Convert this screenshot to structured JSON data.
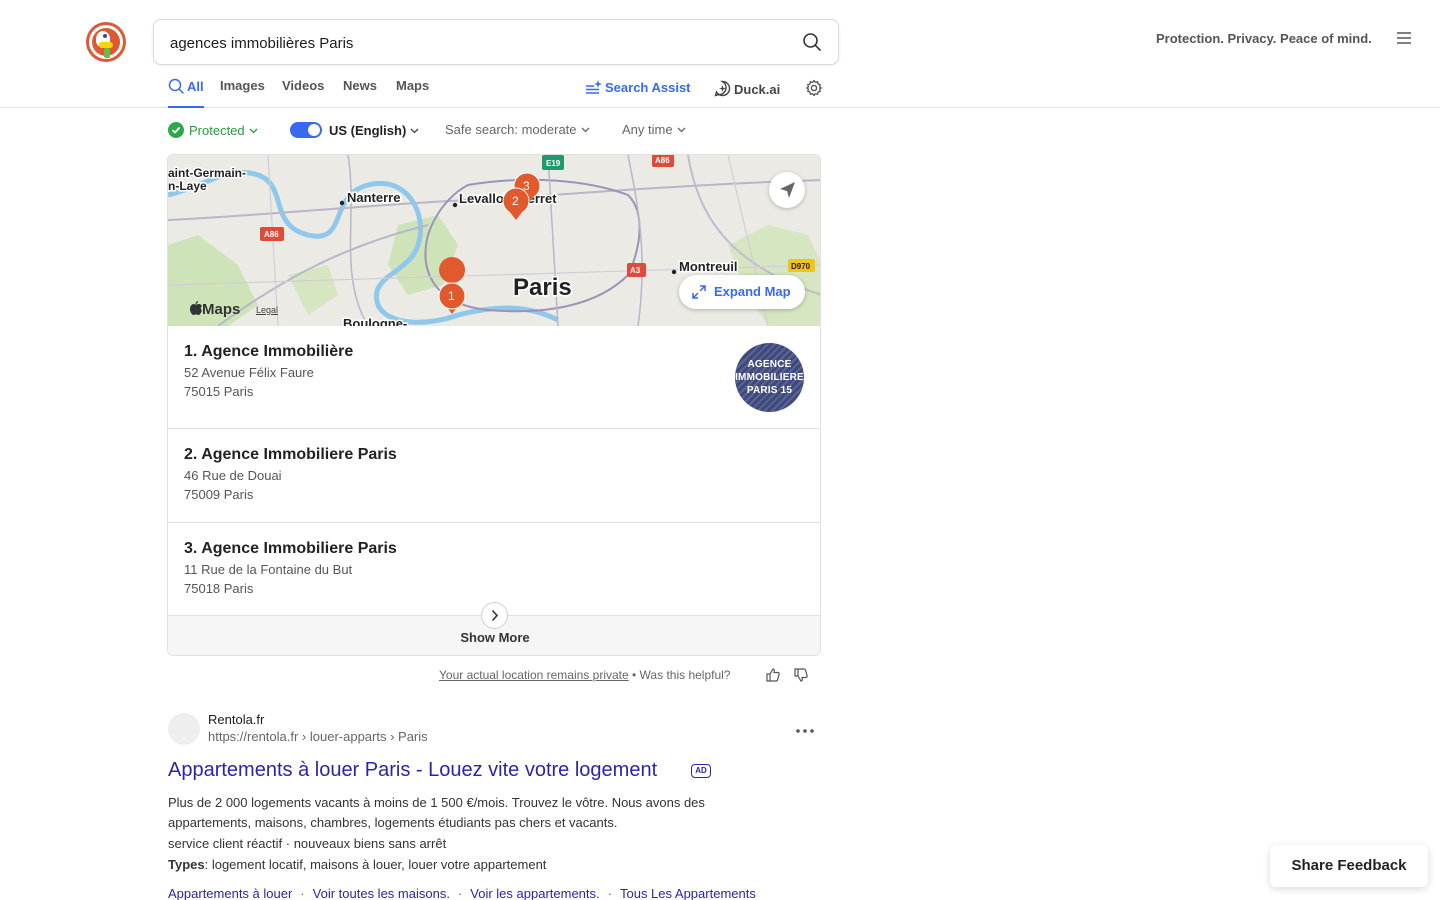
{
  "search": {
    "query": "agences immobilières Paris",
    "button_icon": "magnifier-icon"
  },
  "header": {
    "tagline": "Protection. Privacy. Peace of mind.",
    "menu_icon": "hamburger-icon"
  },
  "tabs": [
    {
      "label": "All",
      "active": true
    },
    {
      "label": "Images"
    },
    {
      "label": "Videos"
    },
    {
      "label": "News"
    },
    {
      "label": "Maps"
    }
  ],
  "assist": {
    "search_assist": "Search Assist",
    "duck_ai": "Duck.ai"
  },
  "filters": {
    "protected": "Protected",
    "region": "US (English)",
    "safe_search": "Safe search: moderate",
    "time": "Any time"
  },
  "map": {
    "labels": {
      "saint_germain_1": "aint-Germain-",
      "saint_germain_2": "n-Laye",
      "nanterre": "Nanterre",
      "levallois": "Levallois-Perret",
      "paris": "Paris",
      "montreuil": "Montreuil",
      "boulogne": "Boulogne-"
    },
    "road_badges": {
      "e19": "E19",
      "a86_top": "A86",
      "a86_left": "A86",
      "a3": "A3",
      "d970": "D970"
    },
    "markers": [
      "1",
      "2",
      "3"
    ],
    "expand_label": "Expand Map",
    "maps_brand": "Maps",
    "legal": "Legal",
    "accent": "#3969ef",
    "marker_color": "#e05a2e"
  },
  "places": [
    {
      "title": "1. Agence Immobilière",
      "line1": "52 Avenue Félix Faure",
      "line2": "75015 Paris",
      "logo_text": [
        "AGENCE",
        "IMMOBILIERE",
        "PARIS 15"
      ]
    },
    {
      "title": "2. Agence Immobiliere Paris",
      "line1": "46 Rue de Douai",
      "line2": "75009 Paris"
    },
    {
      "title": "3. Agence Immobiliere Paris",
      "line1": "11 Rue de la Fontaine du But",
      "line2": "75018 Paris"
    }
  ],
  "show_more": "Show More",
  "privacy": {
    "link": "Your actual location remains private",
    "question": "• Was this helpful?"
  },
  "result": {
    "site_name": "Rentola.fr",
    "url": "https://rentola.fr › louer-apparts › Paris",
    "title": "Appartements à louer Paris - Louez vite votre logement",
    "ad": "AD",
    "snippet1": "Plus de 2 000 logements vacants à moins de 1 500 €/mois. Trouvez le vôtre. Nous avons des",
    "snippet2": "appartements, maisons, chambres, logements étudiants pas chers et vacants.",
    "snippet3": "service client réactif · nouveaux biens sans arrêt",
    "types_label": "Types",
    "types_value": ": logement locatif, maisons à louer, louer votre appartement",
    "sitelinks": [
      "Appartements à louer",
      "Voir toutes les maisons.",
      "Voir les appartements.",
      "Tous Les Appartements"
    ],
    "sitelink_sep": "·"
  },
  "feedback": "Share Feedback"
}
